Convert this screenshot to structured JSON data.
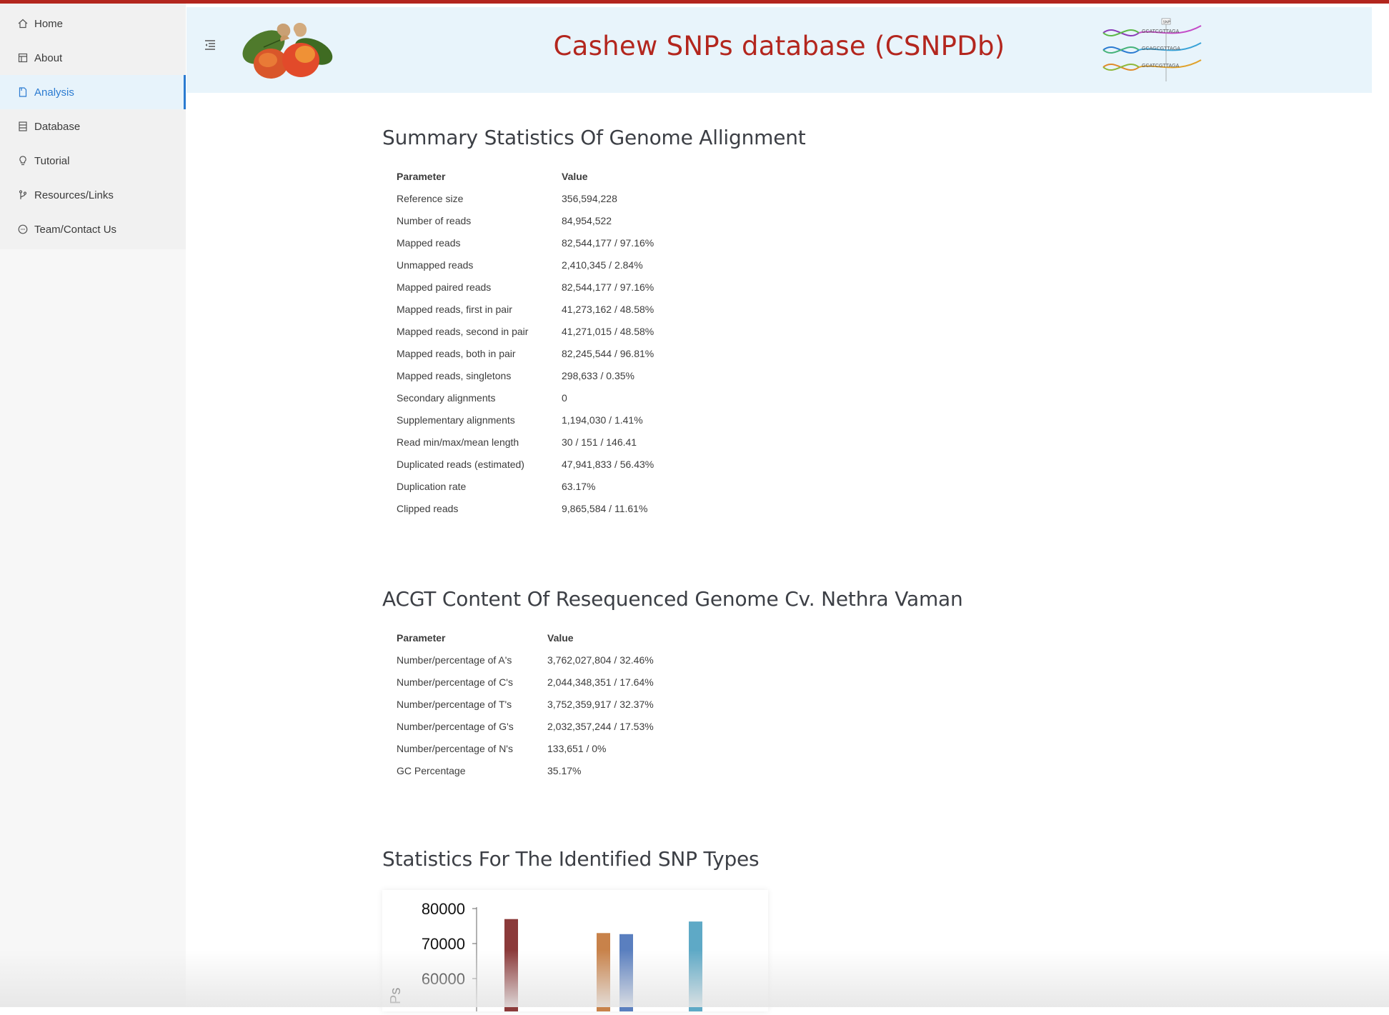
{
  "sidebar": {
    "items": [
      {
        "label": "Home",
        "icon": "home-icon"
      },
      {
        "label": "About",
        "icon": "layout-icon"
      },
      {
        "label": "Analysis",
        "icon": "document-icon",
        "active": true
      },
      {
        "label": "Database",
        "icon": "database-icon"
      },
      {
        "label": "Tutorial",
        "icon": "bulb-icon"
      },
      {
        "label": "Resources/Links",
        "icon": "branch-icon"
      },
      {
        "label": "Team/Contact Us",
        "icon": "chat-icon"
      }
    ]
  },
  "header": {
    "title": "Cashew SNPs database (CSNPDb)",
    "title_color": "#b3261e",
    "background": "#e8f4fb",
    "dna_logo_letters": [
      "GCATCGTTAGA",
      "GCAGCGTTAGA",
      "GCATCGTTAGA"
    ],
    "dna_logo_tag": "SNP"
  },
  "sections": {
    "alignment": {
      "title": "Summary Statistics Of Genome Allignment",
      "headers": [
        "Parameter",
        "Value"
      ],
      "rows": [
        [
          "Reference size",
          "356,594,228"
        ],
        [
          "Number of reads",
          "84,954,522"
        ],
        [
          "Mapped reads",
          "82,544,177 / 97.16%"
        ],
        [
          "Unmapped reads",
          "2,410,345 / 2.84%"
        ],
        [
          "Mapped paired reads",
          "82,544,177 / 97.16%"
        ],
        [
          "Mapped reads, first in pair",
          "41,273,162 / 48.58%"
        ],
        [
          "Mapped reads, second in pair",
          "41,271,015 / 48.58%"
        ],
        [
          "Mapped reads, both in pair",
          "82,245,544 / 96.81%"
        ],
        [
          "Mapped reads, singletons",
          "298,633 / 0.35%"
        ],
        [
          "Secondary alignments",
          "0"
        ],
        [
          "Supplementary alignments",
          "1,194,030 / 1.41%"
        ],
        [
          "Read min/max/mean length",
          "30 / 151 / 146.41"
        ],
        [
          "Duplicated reads (estimated)",
          "47,941,833 / 56.43%"
        ],
        [
          "Duplication rate",
          "63.17%"
        ],
        [
          "Clipped reads",
          "9,865,584 / 11.61%"
        ]
      ]
    },
    "acgt": {
      "title": "ACGT Content Of Resequenced Genome Cv. Nethra Vaman",
      "headers": [
        "Parameter",
        "Value"
      ],
      "rows": [
        [
          "Number/percentage of A's",
          "3,762,027,804 / 32.46%"
        ],
        [
          "Number/percentage of C's",
          "2,044,348,351 / 17.64%"
        ],
        [
          "Number/percentage of T's",
          "3,752,359,917 / 32.37%"
        ],
        [
          "Number/percentage of G's",
          "2,032,357,244 / 17.53%"
        ],
        [
          "Number/percentage of N's",
          "133,651 / 0%"
        ],
        [
          "GC Percentage",
          "35.17%"
        ]
      ]
    },
    "snp_types": {
      "title": "Statistics For The Identified SNP Types"
    }
  },
  "chart_data": {
    "type": "bar",
    "ylim": [
      55000,
      80000
    ],
    "yticks": [
      "80000",
      "70000",
      "60000"
    ],
    "ytick_values": [
      80000,
      70000,
      60000
    ],
    "ylabel_fragment": "Ps",
    "bars": [
      {
        "value": 77000,
        "color": "#8b3a3a"
      },
      {
        "value": 73000,
        "color": "#c8824a"
      },
      {
        "value": 72700,
        "color": "#5a7fbf"
      },
      {
        "value": 76300,
        "color": "#5ea9c6"
      }
    ]
  }
}
